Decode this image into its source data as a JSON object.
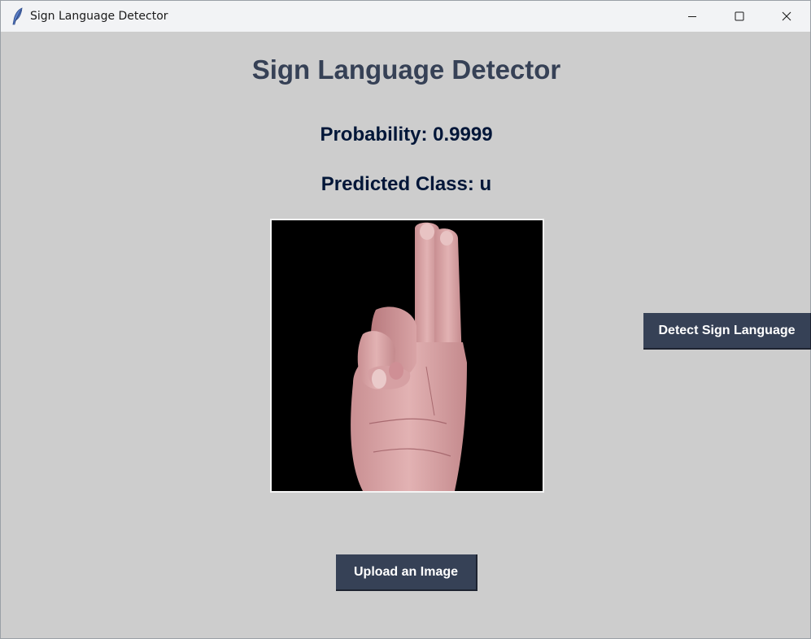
{
  "window": {
    "title": "Sign Language Detector",
    "icon": "feather-icon",
    "controls": [
      "minimize-icon",
      "maximize-icon",
      "close-icon"
    ]
  },
  "main": {
    "heading": "Sign Language Detector",
    "probability": "Probability: 0.9999",
    "predicted_class": "Predicted Class: u",
    "image": "hand-sign-image",
    "detect_button": "Detect Sign Language",
    "upload_button": "Upload an Image"
  },
  "colors": {
    "background": "#cdcdcd",
    "heading": "#364156",
    "result_text": "#011638",
    "button_bg": "#364156",
    "button_text": "#ffffff"
  }
}
